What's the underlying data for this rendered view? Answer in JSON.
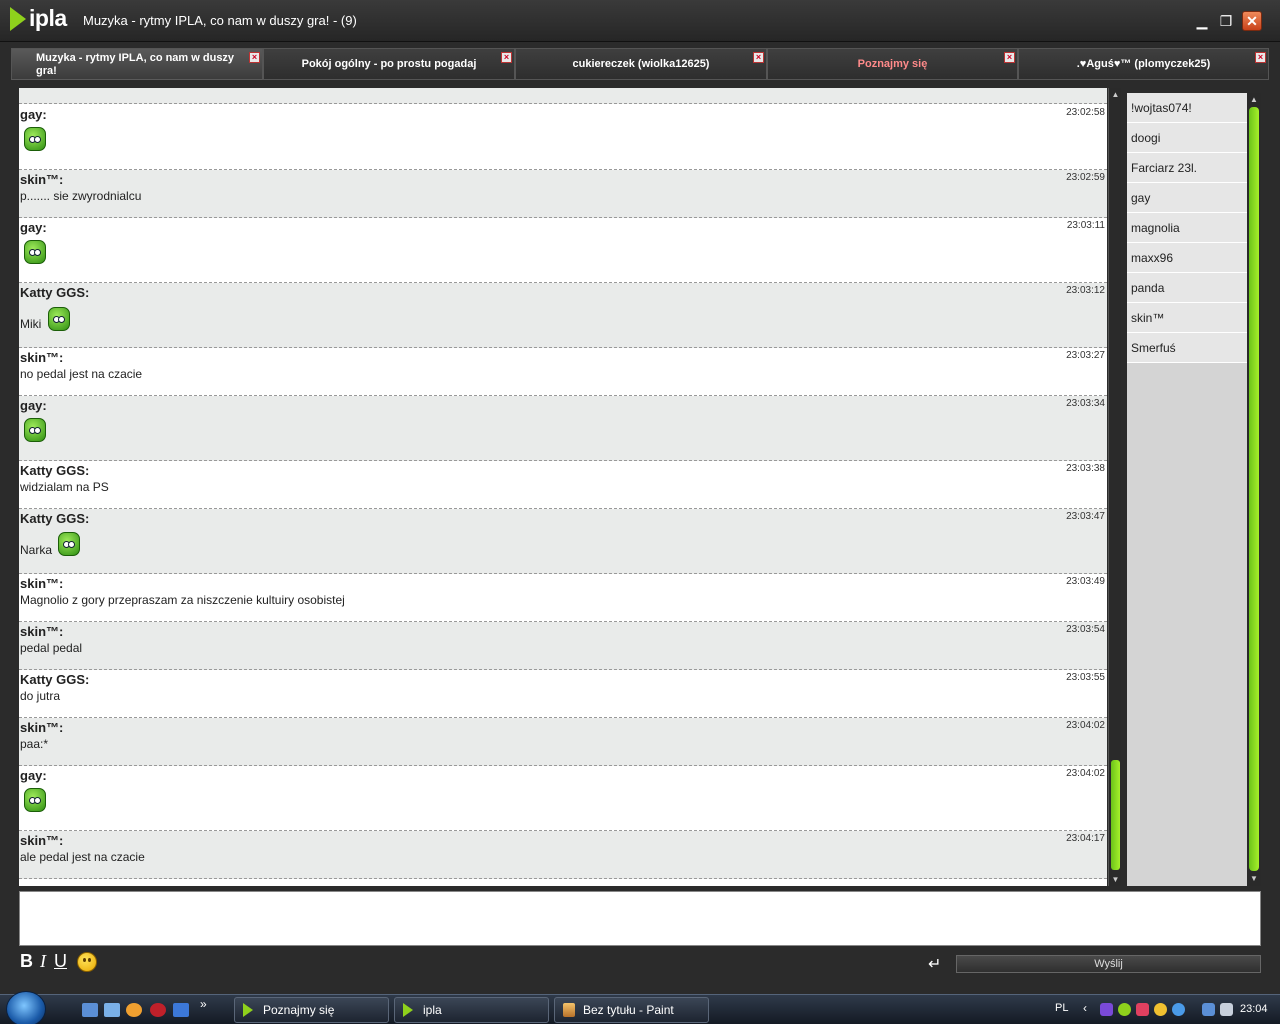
{
  "window": {
    "app_name": "ipla",
    "title": "Muzyka - rytmy IPLA, co nam w duszy gra! - (9)"
  },
  "tabs": [
    {
      "label": "Muzyka - rytmy IPLA, co nam w duszy gra!",
      "active": true
    },
    {
      "label": "Pokój ogólny - po prostu pogadaj",
      "active": false
    },
    {
      "label": "cukiereczek (wiolka12625)",
      "active": false
    },
    {
      "label": "Poznajmy się",
      "active": false,
      "highlight": true
    },
    {
      "label": ".♥Aguś♥™ (plomyczek25)",
      "active": false
    }
  ],
  "messages": [
    {
      "author": "gay:",
      "time": "23:02:58",
      "text": "",
      "emoticon": "green-emoticon-icon"
    },
    {
      "author": "skin™:",
      "time": "23:02:59",
      "text": "p....... sie zwyrodnialcu"
    },
    {
      "author": "gay:",
      "time": "23:03:11",
      "text": "",
      "emoticon": "green-emoticon-icon"
    },
    {
      "author": "Katty GGS:",
      "time": "23:03:12",
      "text": "Miki",
      "emoticon": "green-emoticon-icon"
    },
    {
      "author": "skin™:",
      "time": "23:03:27",
      "text": "no pedal jest na czacie"
    },
    {
      "author": "gay:",
      "time": "23:03:34",
      "text": "",
      "emoticon": "green-emoticon-icon"
    },
    {
      "author": "Katty GGS:",
      "time": "23:03:38",
      "text": "widzialam na PS"
    },
    {
      "author": "Katty GGS:",
      "time": "23:03:47",
      "text": "Narka",
      "emoticon": "green-emoticon-icon"
    },
    {
      "author": "skin™:",
      "time": "23:03:49",
      "text": "Magnolio z gory przepraszam za niszczenie kultuiry osobistej"
    },
    {
      "author": "skin™:",
      "time": "23:03:54",
      "text": "pedal pedal"
    },
    {
      "author": "Katty GGS:",
      "time": "23:03:55",
      "text": "do jutra"
    },
    {
      "author": "skin™:",
      "time": "23:04:02",
      "text": "paa:*"
    },
    {
      "author": "gay:",
      "time": "23:04:02",
      "text": "",
      "emoticon": "green-emoticon-icon"
    },
    {
      "author": "skin™:",
      "time": "23:04:17",
      "text": "ale pedal jest na czacie"
    }
  ],
  "users": [
    "!wojtas074!",
    "doogi",
    "Farciarz 23l.",
    "gay",
    "magnolia",
    "maxx96",
    "panda",
    "skin™",
    "Smerfuś"
  ],
  "composer": {
    "bold_label": "B",
    "italic_label": "I",
    "underline_label": "U",
    "enter_symbol": "↵",
    "send_label": "Wyślij"
  },
  "taskbar": {
    "items": [
      {
        "label": "Poznajmy się",
        "icon": "ipla-icon"
      },
      {
        "label": "ipla",
        "icon": "ipla-icon"
      },
      {
        "label": "Bez tytułu - Paint",
        "icon": "paint-icon"
      }
    ],
    "language": "PL",
    "clock": "23:04"
  },
  "colors": {
    "accent_green": "#8fd11c",
    "tab_highlight": "#ff8a8a",
    "row_alt": "#e9ebea"
  }
}
